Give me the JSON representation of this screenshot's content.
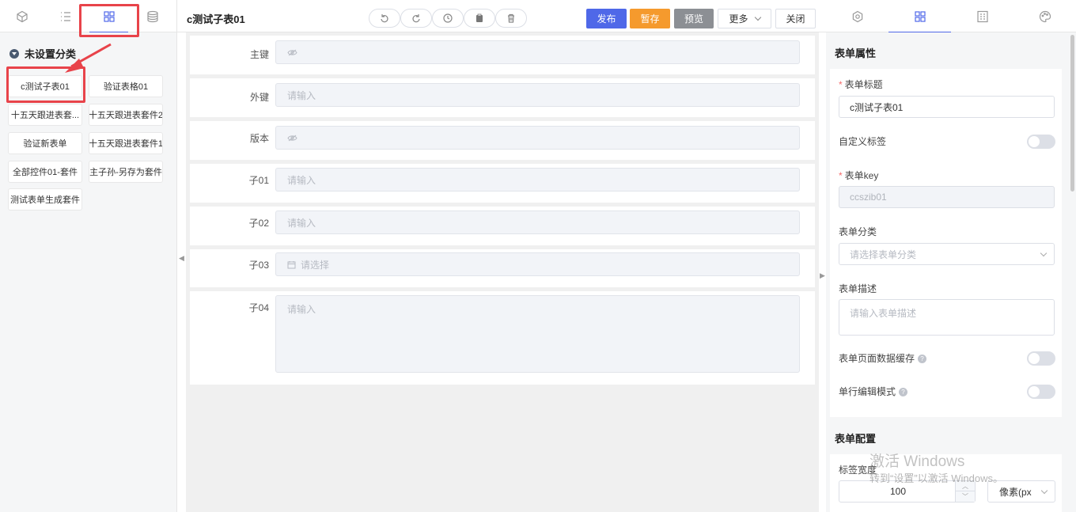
{
  "left_panel": {
    "tabs": [
      {
        "icon": "cube-icon"
      },
      {
        "icon": "list-icon"
      },
      {
        "icon": "grid-icon",
        "active": true
      },
      {
        "icon": "database-icon"
      }
    ],
    "group_title": "未设置分类",
    "forms": [
      "c测试子表01",
      "验证表格01",
      "十五天跟进表套...",
      "十五天跟进表套件2",
      "验证新表单",
      "十五天跟进表套件1",
      "全部控件01-套件",
      "主子孙-另存为套件",
      "测试表单生成套件"
    ]
  },
  "toolbar": {
    "title": "c测试子表01",
    "tools": [
      "undo-icon",
      "redo-icon",
      "history-icon",
      "clipboard-icon",
      "trash-icon"
    ],
    "publish": "发布",
    "save": "暂存",
    "preview": "预览",
    "more": "更多",
    "close": "关闭"
  },
  "canvas": {
    "fields": [
      {
        "label": "主键",
        "placeholder": "",
        "icon": "eye-icon"
      },
      {
        "label": "外键",
        "placeholder": "请输入"
      },
      {
        "label": "版本",
        "placeholder": "",
        "icon": "eye-icon"
      },
      {
        "label": "子01",
        "placeholder": "请输入"
      },
      {
        "label": "子02",
        "placeholder": "请输入"
      },
      {
        "label": "子03",
        "placeholder": "请选择",
        "icon": "calendar-icon"
      },
      {
        "label": "子04",
        "placeholder": "请输入"
      }
    ]
  },
  "right_panel": {
    "tabs": [
      {
        "icon": "settings-icon"
      },
      {
        "icon": "grid-icon",
        "active": true
      },
      {
        "icon": "form-layout-icon"
      },
      {
        "icon": "palette-icon"
      }
    ],
    "form_props_title": "表单属性",
    "form_title_label": "表单标题",
    "form_title_value": "c测试子表01",
    "custom_label": "自定义标签",
    "form_key_label": "表单key",
    "form_key_value": "ccszib01",
    "category_label": "表单分类",
    "category_placeholder": "请选择表单分类",
    "desc_label": "表单描述",
    "desc_placeholder": "请输入表单描述",
    "cache_label": "表单页面数据缓存",
    "inline_edit_label": "单行编辑模式",
    "form_config_title": "表单配置",
    "label_width_label": "标签宽度",
    "label_width_value": "100",
    "unit_value": "像素(px"
  },
  "watermark": {
    "line1": "激活 Windows",
    "line2": "转到“设置”以激活 Windows。"
  },
  "colors": {
    "accent": "#4f68e8",
    "publish": "#4f68e8",
    "save": "#f59a2d",
    "preview": "#8c8f94",
    "highlight": "#e8434a"
  }
}
